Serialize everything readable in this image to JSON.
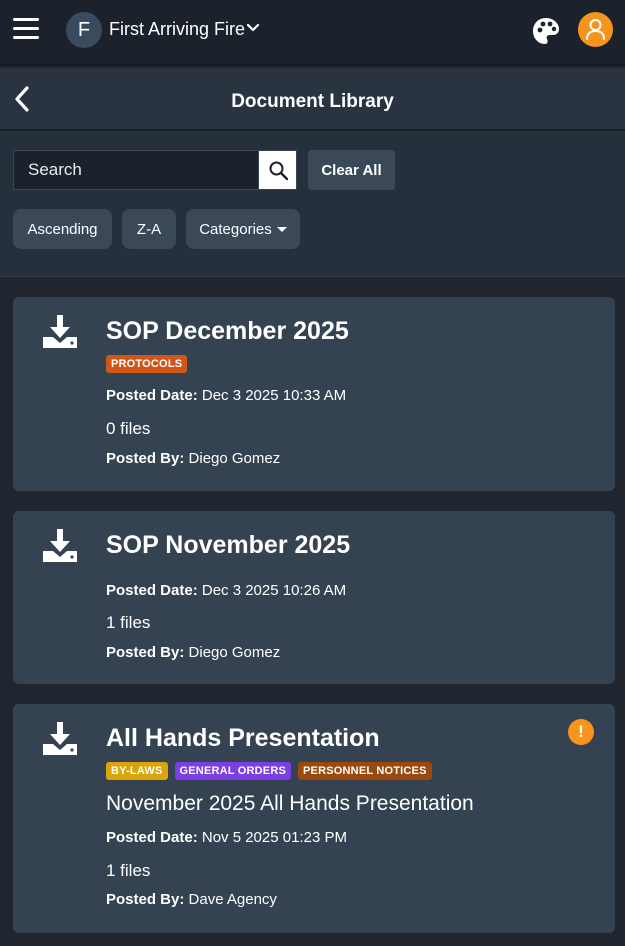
{
  "header": {
    "org_initial": "F",
    "org_name": "First Arriving Fire",
    "accent_color": "#f7941d"
  },
  "page": {
    "title": "Document Library"
  },
  "filters": {
    "search_placeholder": "Search",
    "search_value": "",
    "clear_label": "Clear All",
    "sort_order": "Ascending",
    "sort_alpha": "Z-A",
    "categories_label": "Categories"
  },
  "documents": [
    {
      "title": "SOP December 2025",
      "tags": [
        {
          "label": "PROTOCOLS",
          "color": "#d0571a"
        }
      ],
      "description": "",
      "posted_date_label": "Posted Date:",
      "posted_date": "Dec 3 2025 10:33 AM",
      "files": "0 files",
      "posted_by_label": "Posted By:",
      "posted_by": "Diego Gomez",
      "alert": false
    },
    {
      "title": "SOP November 2025",
      "tags": [],
      "description": "",
      "posted_date_label": "Posted Date:",
      "posted_date": "Dec 3 2025 10:26 AM",
      "files": "1 files",
      "posted_by_label": "Posted By:",
      "posted_by": "Diego Gomez",
      "alert": false
    },
    {
      "title": "All Hands Presentation",
      "tags": [
        {
          "label": "BY-LAWS",
          "color": "#d9a509"
        },
        {
          "label": "GENERAL ORDERS",
          "color": "#7b3fe4"
        },
        {
          "label": "PERSONNEL NOTICES",
          "color": "#9a4a0e"
        }
      ],
      "description": "November 2025 All Hands Presentation",
      "posted_date_label": "Posted Date:",
      "posted_date": "Nov 5 2025 01:23 PM",
      "files": "1 files",
      "posted_by_label": "Posted By:",
      "posted_by": "Dave Agency",
      "alert": true,
      "alert_symbol": "!"
    }
  ]
}
